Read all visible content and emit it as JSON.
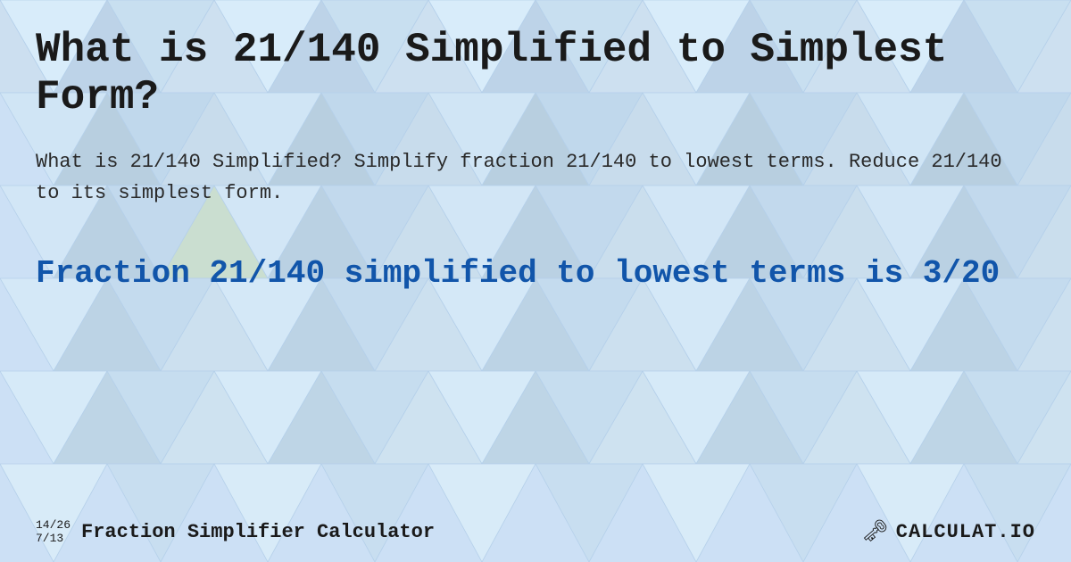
{
  "page": {
    "title": "What is 21/140 Simplified to Simplest Form?",
    "description": "What is 21/140 Simplified? Simplify fraction 21/140 to lowest terms. Reduce 21/140 to its simplest form.",
    "result_heading": "Fraction 21/140 simplified to lowest terms is 3/20",
    "background_color": "#d6e8f7",
    "accent_color": "#1155aa"
  },
  "footer": {
    "fraction1": "14/26",
    "fraction2": "7/13",
    "label": "Fraction Simplifier Calculator",
    "logo": "CALCULAT.IO"
  }
}
